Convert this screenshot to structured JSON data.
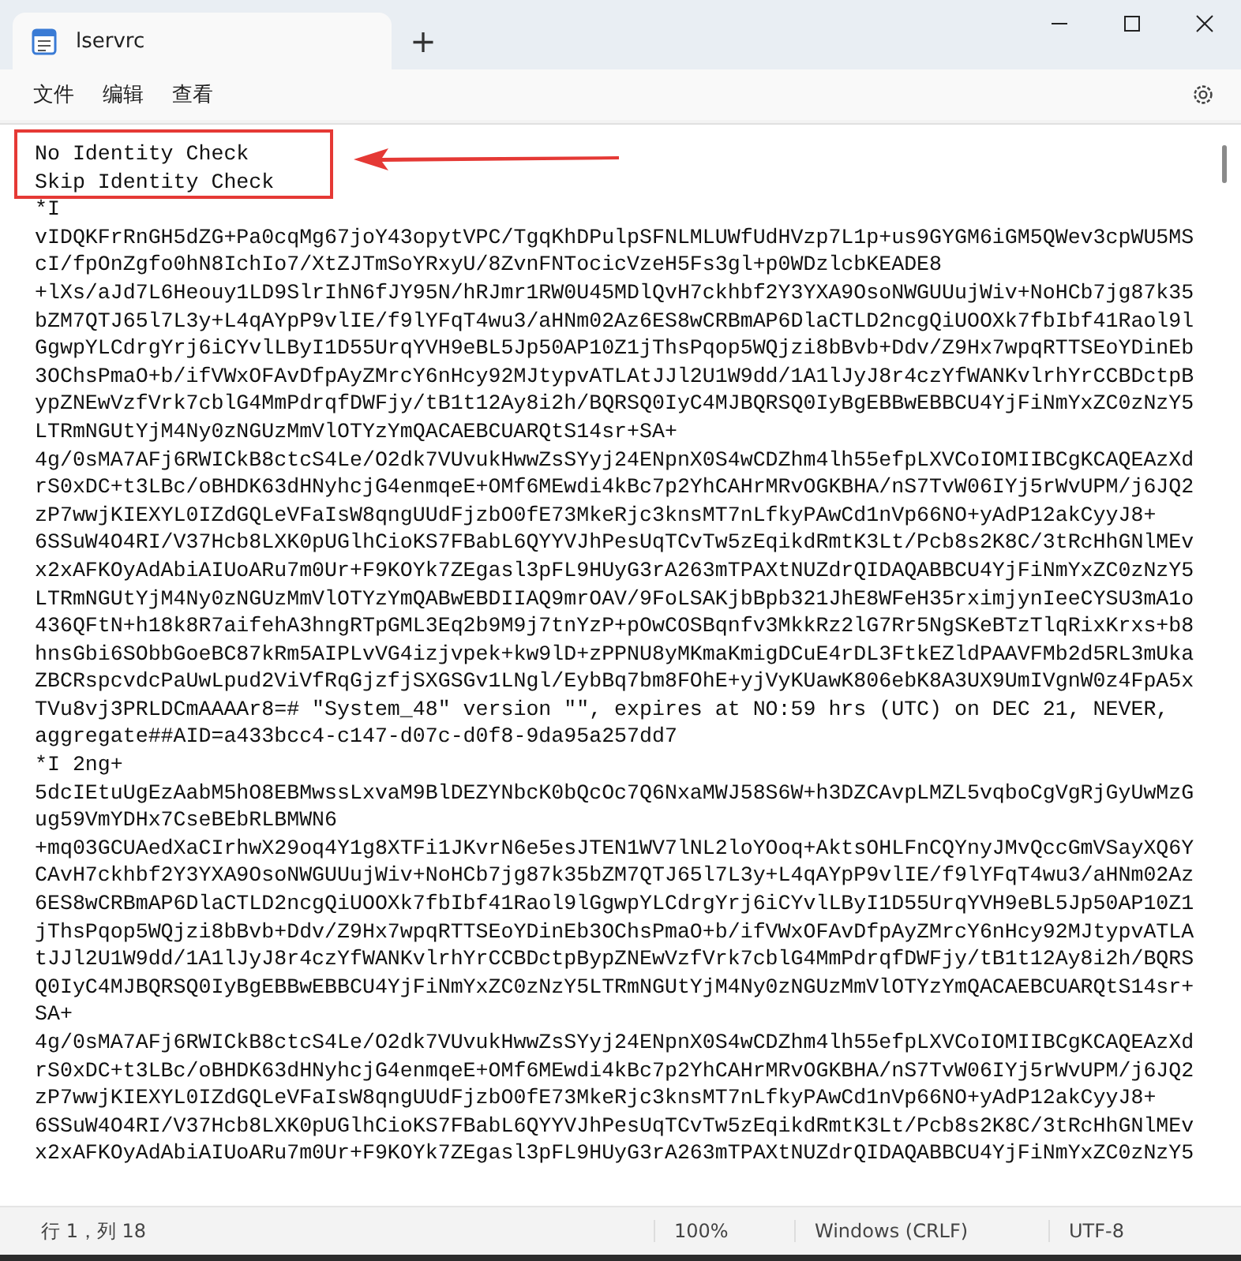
{
  "window": {
    "tab_title": "lservrc",
    "new_tab": "+"
  },
  "menu": [
    "文件",
    "编辑",
    "查看"
  ],
  "editor": {
    "lines": [
      "No Identity Check",
      "Skip Identity Check",
      "*I",
      "vIDQKFrRnGH5dZG+Pa0cqMg67joY43opytVPC/TgqKhDPulpSFNLMLUWfUdHVzp7L1p+us9GYGM6iGM5QWev3cpWU5MS",
      "cI/fpOnZgfo0hN8IchIo7/XtZJTmSoYRxyU/8ZvnFNTocicVzeH5Fs3gl+p0WDzlcbKEADE8",
      "+lXs/aJd7L6Heouy1LD9SlrIhN6fJY95N/hRJmr1RW0U45MDlQvH7ckhbf2Y3YXA9OsoNWGUUujWiv+NoHCb7jg87k35",
      "bZM7QTJ65l7L3y+L4qAYpP9vlIE/f9lYFqT4wu3/aHNm02Az6ES8wCRBmAP6DlaCTLD2ncgQiUOOXk7fbIbf41Raol9l",
      "GgwpYLCdrgYrj6iCYvlLByI1D55UrqYVH9eBL5Jp50AP10Z1jThsPqop5WQjzi8bBvb+Ddv/Z9Hx7wpqRTTSEoYDinEb",
      "3OChsPmaO+b/ifVWxOFAvDfpAyZMrcY6nHcy92MJtypvATLAtJJl2U1W9dd/1A1lJyJ8r4czYfWANKvlrhYrCCBDctpB",
      "ypZNEwVzfVrk7cblG4MmPdrqfDWFjy/tB1t12Ay8i2h/BQRSQ0IyC4MJBQRSQ0IyBgEBBwEBBCU4YjFiNmYxZC0zNzY5",
      "LTRmNGUtYjM4Ny0zNGUzMmVlOTYzYmQACAEBCUARQtS14sr+SA+",
      "4g/0sMA7AFj6RWICkB8ctcS4Le/O2dk7VUvukHwwZsSYyj24ENpnX0S4wCDZhm4lh55efpLXVCoIOMIIBCgKCAQEAzXd",
      "rS0xDC+t3LBc/oBHDK63dHNyhcjG4enmqeE+OMf6MEwdi4kBc7p2YhCAHrMRvOGKBHA/nS7TvW06IYj5rWvUPM/j6JQ2",
      "zP7wwjKIEXYL0IZdGQLeVFaIsW8qngUUdFjzbO0fE73MkeRjc3knsMT7nLfkyPAwCd1nVp66NO+yAdP12akCyyJ8+",
      "6SSuW4O4RI/V37Hcb8LXK0pUGlhCioKS7FBabL6QYYVJhPesUqTCvTw5zEqikdRmtK3Lt/Pcb8s2K8C/3tRcHhGNlMEv",
      "x2xAFKOyAdAbiAIUoARu7m0Ur+F9KOYk7ZEgasl3pFL9HUyG3rA263mTPAXtNUZdrQIDAQABBCU4YjFiNmYxZC0zNzY5",
      "LTRmNGUtYjM4Ny0zNGUzMmVlOTYzYmQABwEBDIIAQ9mrOAV/9FoLSAKjbBpb321JhE8WFeH35rximjynIeeCYSU3mA1o",
      "436QFtN+h18k8R7aifehA3hngRTpGML3Eq2b9M9j7tnYzP+pOwCOSBqnfv3MkkRz2lG7Rr5NgSKeBTzTlqRixKrxs+b8",
      "hnsGbi6SObbGoeBC87kRm5AIPLvVG4izjvpek+kw9lD+zPPNU8yMKmaKmigDCuE4rDL3FtkEZldPAAVFMb2d5RL3mUka",
      "ZBCRspcvdcPaUwLpud2ViVfRqGjzfjSXGSGv1LNgl/EybBq7bm8FOhE+yjVyKUawK806ebK8A3UX9UmIVgnW0z4FpA5x",
      "TVu8vj3PRLDCmAAAAr8=# \"System_48\" version \"\", expires at NO:59 hrs (UTC) on DEC 21, NEVER,",
      "aggregate##AID=a433bcc4-c147-d07c-d0f8-9da95a257dd7",
      "*I 2ng+",
      "5dcIEtuUgEzAabM5hO8EBMwssLxvaM9BlDEZYNbcK0bQcOc7Q6NxaMWJ58S6W+h3DZCAvpLMZL5vqboCgVgRjGyUwMzG",
      "ug59VmYDHx7CseBEbRLBMWN6",
      "+mq03GCUAedXaCIrhwX29oq4Y1g8XTFi1JKvrN6e5esJTEN1WV7lNL2loYOoq+AktsOHLFnCQYnyJMvQccGmVSayXQ6Y",
      "CAvH7ckhbf2Y3YXA9OsoNWGUUujWiv+NoHCb7jg87k35bZM7QTJ65l7L3y+L4qAYpP9vlIE/f9lYFqT4wu3/aHNm02Az",
      "6ES8wCRBmAP6DlaCTLD2ncgQiUOOXk7fbIbf41Raol9lGgwpYLCdrgYrj6iCYvlLByI1D55UrqYVH9eBL5Jp50AP10Z1",
      "jThsPqop5WQjzi8bBvb+Ddv/Z9Hx7wpqRTTSEoYDinEb3OChsPmaO+b/ifVWxOFAvDfpAyZMrcY6nHcy92MJtypvATLA",
      "tJJl2U1W9dd/1A1lJyJ8r4czYfWANKvlrhYrCCBDctpBypZNEwVzfVrk7cblG4MmPdrqfDWFjy/tB1t12Ay8i2h/BQRS",
      "Q0IyC4MJBQRSQ0IyBgEBBwEBBCU4YjFiNmYxZC0zNzY5LTRmNGUtYjM4Ny0zNGUzMmVlOTYzYmQACAEBCUARQtS14sr+",
      "SA+",
      "4g/0sMA7AFj6RWICkB8ctcS4Le/O2dk7VUvukHwwZsSYyj24ENpnX0S4wCDZhm4lh55efpLXVCoIOMIIBCgKCAQEAzXd",
      "rS0xDC+t3LBc/oBHDK63dHNyhcjG4enmqeE+OMf6MEwdi4kBc7p2YhCAHrMRvOGKBHA/nS7TvW06IYj5rWvUPM/j6JQ2",
      "zP7wwjKIEXYL0IZdGQLeVFaIsW8qngUUdFjzbO0fE73MkeRjc3knsMT7nLfkyPAwCd1nVp66NO+yAdP12akCyyJ8+",
      "6SSuW4O4RI/V37Hcb8LXK0pUGlhCioKS7FBabL6QYYVJhPesUqTCvTw5zEqikdRmtK3Lt/Pcb8s2K8C/3tRcHhGNlMEv",
      "x2xAFKOyAdAbiAIUoARu7m0Ur+F9KOYk7ZEgasl3pFL9HUyG3rA263mTPAXtNUZdrQIDAQABBCU4YjFiNmYxZC0zNzY5"
    ]
  },
  "status_bar": [
    "行 1，列 18",
    "100%",
    "Windows (CRLF)",
    "UTF-8"
  ]
}
